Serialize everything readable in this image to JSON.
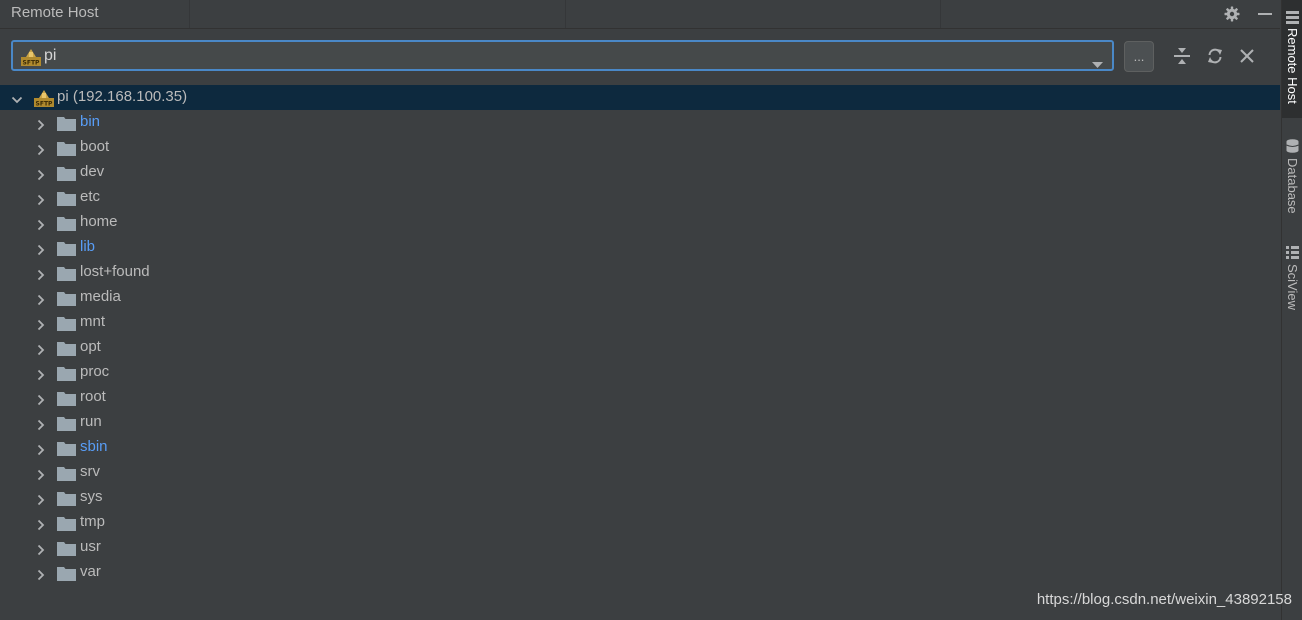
{
  "panel": {
    "title": "Remote Host"
  },
  "toolbar": {
    "selected_connection": "pi",
    "browse_label": "..."
  },
  "tree": {
    "root": {
      "label": "pi (192.168.100.35)",
      "expanded": true
    },
    "items": [
      {
        "name": "bin",
        "symlink": true
      },
      {
        "name": "boot",
        "symlink": false
      },
      {
        "name": "dev",
        "symlink": false
      },
      {
        "name": "etc",
        "symlink": false
      },
      {
        "name": "home",
        "symlink": false
      },
      {
        "name": "lib",
        "symlink": true
      },
      {
        "name": "lost+found",
        "symlink": false
      },
      {
        "name": "media",
        "symlink": false
      },
      {
        "name": "mnt",
        "symlink": false
      },
      {
        "name": "opt",
        "symlink": false
      },
      {
        "name": "proc",
        "symlink": false
      },
      {
        "name": "root",
        "symlink": false
      },
      {
        "name": "run",
        "symlink": false
      },
      {
        "name": "sbin",
        "symlink": true
      },
      {
        "name": "srv",
        "symlink": false
      },
      {
        "name": "sys",
        "symlink": false
      },
      {
        "name": "tmp",
        "symlink": false
      },
      {
        "name": "usr",
        "symlink": false
      },
      {
        "name": "var",
        "symlink": false
      }
    ]
  },
  "sidebar": {
    "tabs": [
      {
        "label": "Remote Host",
        "icon": "remote-host-icon",
        "active": true
      },
      {
        "label": "Database",
        "icon": "database-icon",
        "active": false
      },
      {
        "label": "SciView",
        "icon": "sciview-icon",
        "active": false
      }
    ]
  },
  "watermark": "https://blog.csdn.net/weixin_43892158",
  "colors": {
    "background": "#3c3f41",
    "selection": "#0d293e",
    "focus_border": "#4a88c7",
    "link_text": "#589df6",
    "text": "#bbbbbb"
  }
}
